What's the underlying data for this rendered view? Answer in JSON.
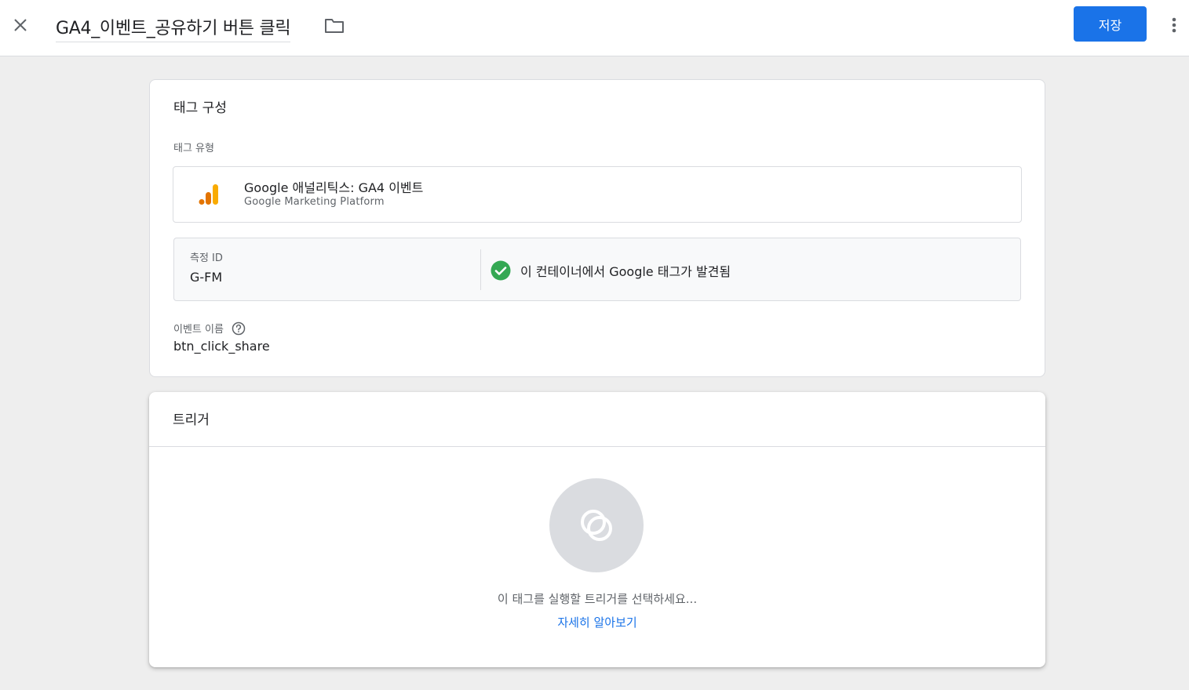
{
  "header": {
    "title": "GA4_이벤트_공유하기 버튼 클릭",
    "save_label": "저장",
    "close_icon": "close-icon",
    "folder_icon": "folder-icon",
    "more_icon": "more-vert-icon"
  },
  "tag_config": {
    "title": "태그 구성",
    "tag_type_label": "태그 유형",
    "tag_type": {
      "name": "Google 애널리틱스: GA4 이벤트",
      "platform": "Google Marketing Platform",
      "icon": "google-analytics-icon"
    },
    "measurement": {
      "label": "측정 ID",
      "value": "G-FM",
      "status_text": "이 컨테이너에서 Google 태그가 발견됨",
      "status_icon": "check-circle-icon",
      "status_color": "#34a853"
    },
    "event_name_label": "이벤트 이름",
    "event_name_value": "btn_click_share"
  },
  "triggering": {
    "title": "트리거",
    "empty_text": "이 태그를 실행할 트리거를 선택하세요...",
    "learn_more": "자세히 알아보기"
  },
  "colors": {
    "accent": "#1a73e8",
    "background": "#eeeeee",
    "ga_orange": "#f9ab00",
    "ga_dark_orange": "#e37400"
  }
}
